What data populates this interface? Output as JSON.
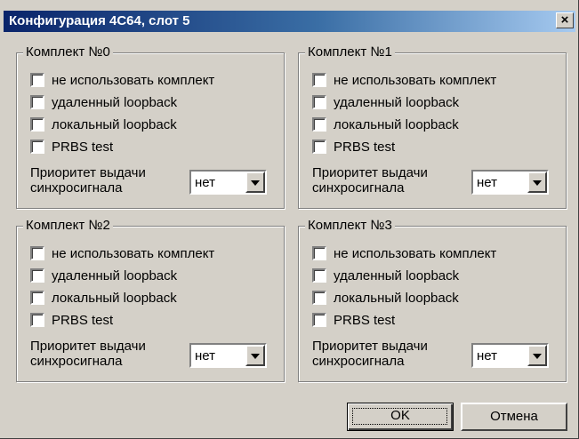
{
  "window": {
    "title": "Конфигурация 4С64, слот 5",
    "close_glyph": "×"
  },
  "groups": [
    {
      "title": "Комплект №0",
      "options": [
        "не использовать комплект",
        "удаленный loopback",
        "локальный loopback",
        "PRBS test"
      ],
      "priority_label_1": "Приоритет выдачи",
      "priority_label_2": "синхросигнала",
      "priority_value": "нет"
    },
    {
      "title": "Комплект №1",
      "options": [
        "не использовать комплект",
        "удаленный loopback",
        "локальный loopback",
        "PRBS test"
      ],
      "priority_label_1": "Приоритет выдачи",
      "priority_label_2": "синхросигнала",
      "priority_value": "нет"
    },
    {
      "title": "Комплект №2",
      "options": [
        "не использовать комплект",
        "удаленный loopback",
        "локальный loopback",
        "PRBS test"
      ],
      "priority_label_1": "Приоритет выдачи",
      "priority_label_2": "синхросигнала",
      "priority_value": "нет"
    },
    {
      "title": "Комплект №3",
      "options": [
        "не использовать комплект",
        "удаленный loopback",
        "локальный loopback",
        "PRBS test"
      ],
      "priority_label_1": "Приоритет выдачи",
      "priority_label_2": "синхросигнала",
      "priority_value": "нет"
    }
  ],
  "buttons": {
    "ok": "OK",
    "cancel": "Отмена"
  },
  "colors": {
    "title_bar_start": "#0a246a",
    "title_bar_end": "#a6caf0",
    "face": "#d4d0c8"
  }
}
